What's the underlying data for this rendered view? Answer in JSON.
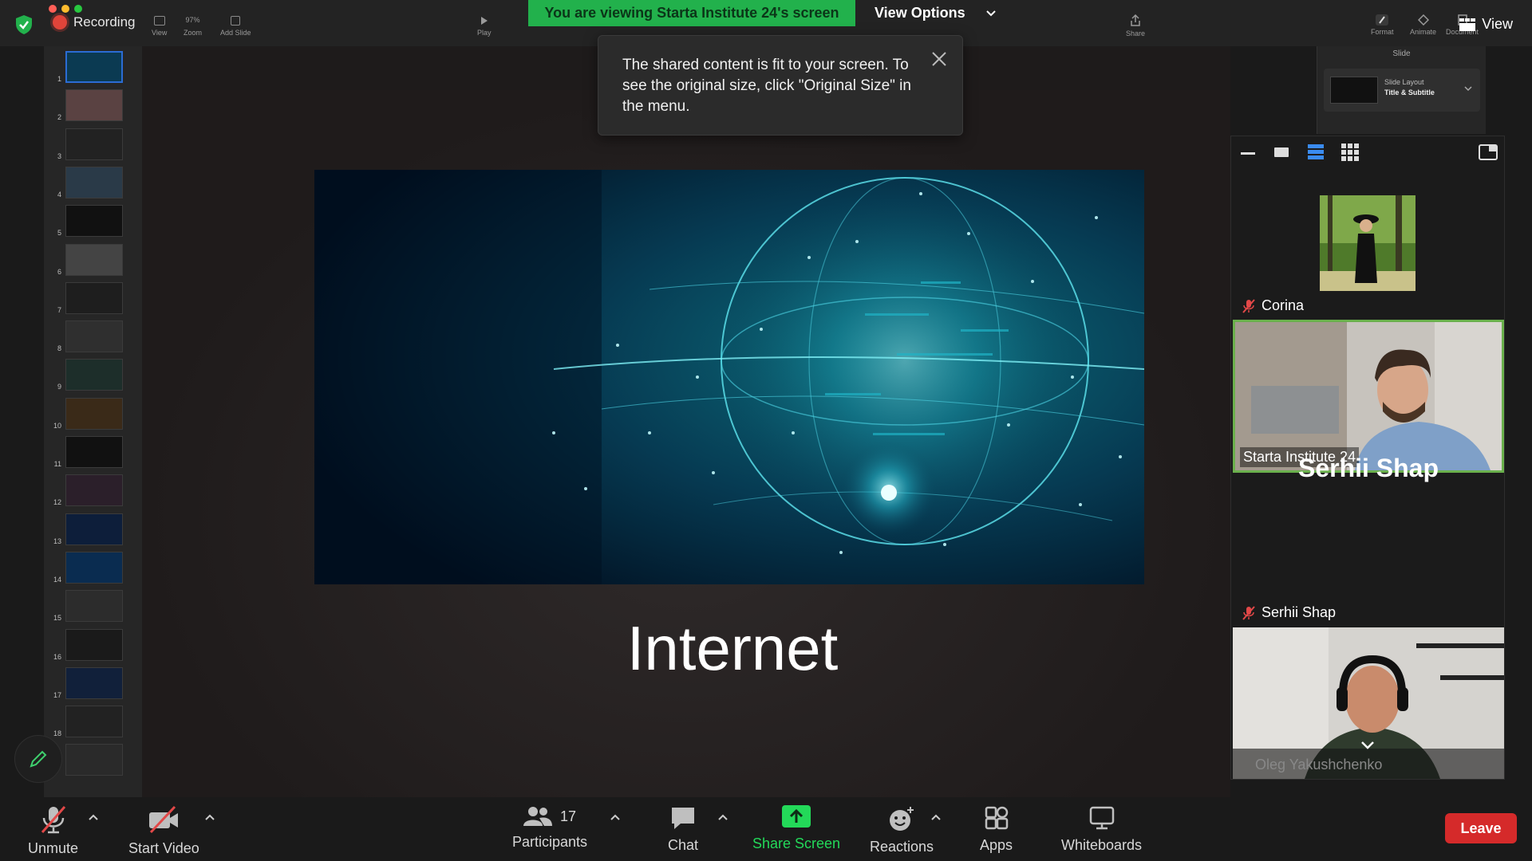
{
  "meeting": {
    "recording_label": "Recording",
    "banner_text": "You are viewing Starta Institute 24's screen",
    "view_options_label": "View Options",
    "view_label": "View",
    "tooltip_text": "The shared content is fit to your screen. To see the original size, click \"Original Size\" in the menu."
  },
  "keynote_toolbar": {
    "view": "View",
    "zoom_value": "97%",
    "zoom": "Zoom",
    "add_slide": "Add Slide",
    "play": "Play",
    "share": "Share",
    "format": "Format",
    "animate": "Animate",
    "document": "Document"
  },
  "inspector": {
    "title": "Slide",
    "layout_label": "Slide Layout",
    "layout_value": "Title & Subtitle"
  },
  "slides": {
    "numbers": [
      "1",
      "2",
      "3",
      "4",
      "5",
      "6",
      "7",
      "8",
      "9",
      "10",
      "11",
      "12",
      "13",
      "14",
      "15",
      "16",
      "17",
      "18"
    ],
    "current_title": "Internet"
  },
  "participants": {
    "count": "17",
    "people": [
      {
        "name": "Corina"
      },
      {
        "name": "Starta Institute 24"
      },
      {
        "name": "Serhii Shap"
      },
      {
        "name": "Serhii Shap"
      },
      {
        "name": "Oleg Yakushchenko"
      }
    ]
  },
  "bottom_toolbar": {
    "unmute": "Unmute",
    "start_video": "Start Video",
    "participants": "Participants",
    "chat": "Chat",
    "share_screen": "Share Screen",
    "reactions": "Reactions",
    "apps": "Apps",
    "whiteboards": "Whiteboards",
    "leave": "Leave"
  },
  "colors": {
    "banner_green": "#22b14c",
    "share_green": "#23d959",
    "leave_red": "#d52a2a",
    "active_speaker": "#6ab04c"
  }
}
